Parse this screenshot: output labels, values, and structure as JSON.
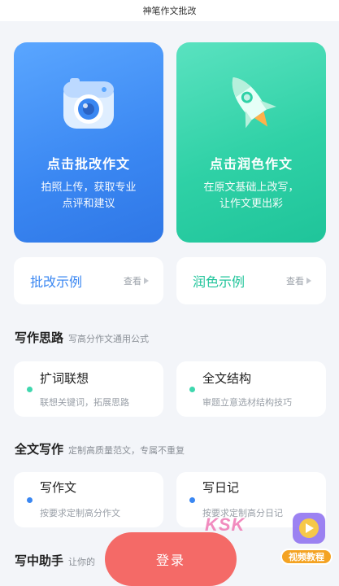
{
  "app": {
    "title": "神笔作文批改"
  },
  "hero": [
    {
      "title": "点击批改作文",
      "desc": "拍照上传，获取专业点评和建议",
      "icon": "camera-icon"
    },
    {
      "title": "点击润色作文",
      "desc": "在原文基础上改写，让作文更出彩",
      "icon": "rocket-icon"
    }
  ],
  "examples": [
    {
      "label": "批改示例",
      "view": "查看"
    },
    {
      "label": "润色示例",
      "view": "查看"
    }
  ],
  "sections": {
    "thinking": {
      "title": "写作思路",
      "subtitle": "写高分作文通用公式",
      "cards": [
        {
          "title": "扩词联想",
          "subtitle": "联想关键词，拓展思路"
        },
        {
          "title": "全文结构",
          "subtitle": "审题立意选材结构技巧"
        }
      ]
    },
    "full": {
      "title": "全文写作",
      "subtitle": "定制高质量范文，专属不重复",
      "cards": [
        {
          "title": "写作文",
          "subtitle": "按要求定制高分作文"
        },
        {
          "title": "写日记",
          "subtitle": "按要求定制高分日记"
        }
      ]
    },
    "helper": {
      "title": "写中助手",
      "subtitle": "让你的"
    }
  },
  "login": {
    "label": "登录"
  },
  "overlay": {
    "brand_text": "KSK",
    "video_badge": "视频教程"
  },
  "colors": {
    "blue": "#3a87f2",
    "green": "#1fc49a",
    "login": "#f46a67"
  }
}
